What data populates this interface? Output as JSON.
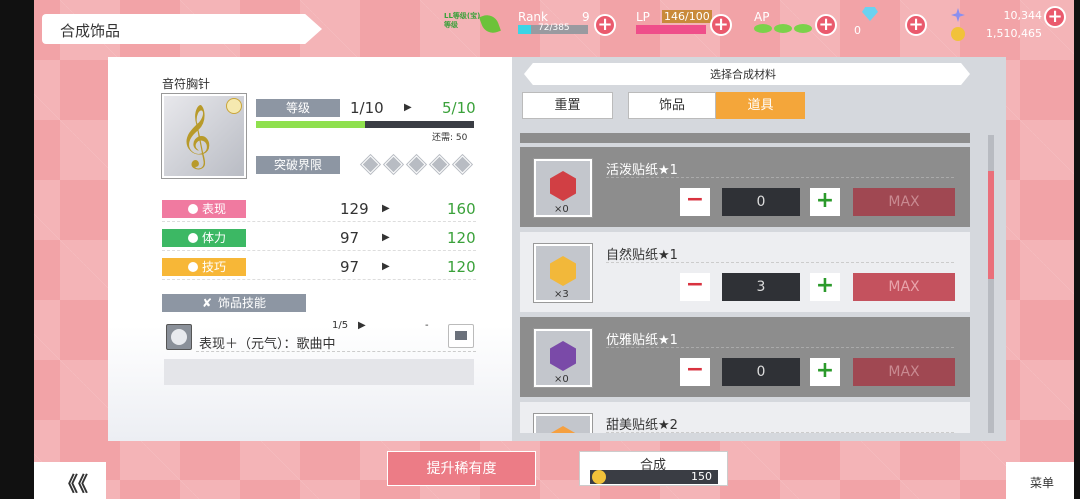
{
  "header": {
    "title": "合成饰品",
    "badge_text": "LL等级(宝)\n等级",
    "rank_label": "Rank",
    "rank_level": "9",
    "rank_exp": "72/385",
    "lp_label": "LP",
    "lp_value": "146/100",
    "ap_label": "AP",
    "gem_count": "0",
    "currency_top": "10,344",
    "currency_bottom": "1,510,465",
    "rank_progress": 0.19
  },
  "accessory": {
    "name": "音符胸针",
    "level_label": "等级",
    "level_current": "1/10",
    "level_next": "5/10",
    "remaining": "还需: 50",
    "level_progress": 0.5,
    "limit_break_label": "突破界限",
    "limit_break_count": 5
  },
  "stats": [
    {
      "label": "表现",
      "current": "129",
      "next": "160",
      "color": "#f07aa0",
      "icon": "smile-icon"
    },
    {
      "label": "体力",
      "current": "97",
      "next": "120",
      "color": "#3cb864",
      "icon": "heart-icon"
    },
    {
      "label": "技巧",
      "current": "97",
      "next": "120",
      "color": "#f7b737",
      "icon": "key-icon"
    }
  ],
  "skill": {
    "section_label": "饰品技能",
    "level": "1/5",
    "dash": "-",
    "description": "表现＋（元气）：歌曲中"
  },
  "materials": {
    "header": "选择合成材料",
    "reset_label": "重置",
    "tab_accessory": "饰品",
    "tab_item": "道具",
    "items": [
      {
        "name": "活泼贴纸★1",
        "owned": "×0",
        "quantity": "0",
        "max_label": "MAX",
        "color": "#d13f44"
      },
      {
        "name": "自然贴纸★1",
        "owned": "×3",
        "quantity": "3",
        "max_label": "MAX",
        "color": "#f2b83a"
      },
      {
        "name": "优雅贴纸★1",
        "owned": "×0",
        "quantity": "0",
        "max_label": "MAX",
        "color": "#7a4aa8"
      },
      {
        "name": "甜美贴纸★2",
        "owned": "",
        "quantity": "",
        "max_label": "",
        "color": "#f5a040"
      }
    ]
  },
  "footer": {
    "back_label": "《《",
    "rarity_button": "提升稀有度",
    "compose_label": "合成",
    "compose_cost": "150",
    "menu_label": "菜单"
  }
}
